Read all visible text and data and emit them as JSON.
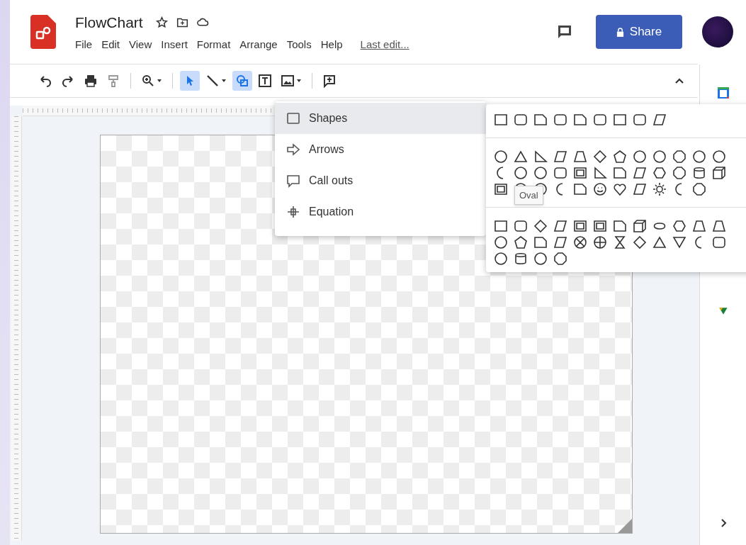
{
  "document": {
    "title": "FlowChart"
  },
  "menu_bar": [
    "File",
    "Edit",
    "View",
    "Insert",
    "Format",
    "Arrange",
    "Tools",
    "Help"
  ],
  "last_edit": "Last edit...",
  "share_button": {
    "label": "Share"
  },
  "toolbar": [
    [
      {
        "kind": "undo",
        "selected": false
      },
      {
        "kind": "redo",
        "selected": false
      },
      {
        "kind": "print",
        "selected": false
      },
      {
        "kind": "paint",
        "selected": false
      }
    ],
    [
      {
        "kind": "zoom",
        "selected": false
      }
    ],
    [
      {
        "kind": "select",
        "selected": true
      },
      {
        "kind": "line",
        "selected": false
      },
      {
        "kind": "shape",
        "selected": true
      },
      {
        "kind": "textbox",
        "selected": false
      },
      {
        "kind": "image",
        "selected": false
      }
    ],
    [
      {
        "kind": "comment",
        "selected": false
      }
    ]
  ],
  "insert_menu": [
    {
      "kind": "shapes",
      "label": "Shapes",
      "selected": true
    },
    {
      "kind": "arrows",
      "label": "Arrows",
      "selected": false
    },
    {
      "kind": "callouts",
      "label": "Call outs",
      "selected": false
    },
    {
      "kind": "equation",
      "label": "Equation",
      "selected": false
    }
  ],
  "tooltip": "Oval"
}
